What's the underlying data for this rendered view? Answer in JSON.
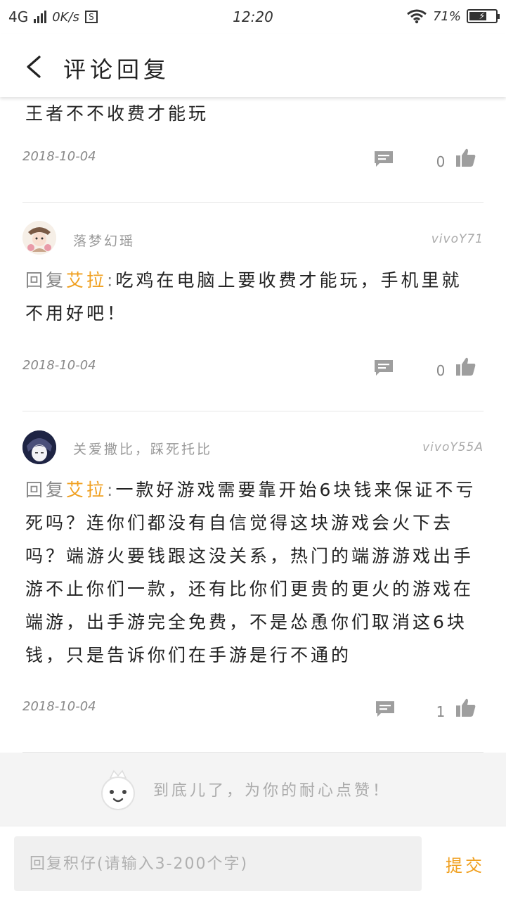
{
  "status_bar": {
    "network": "4G",
    "speed": "0K/s",
    "sim_badge": "S",
    "time": "12:20",
    "battery_text": "71%",
    "battery_level_percent": 71,
    "icons": [
      "signal-icon",
      "sim-icon",
      "wifi-icon",
      "battery-icon"
    ]
  },
  "header": {
    "title": "评论回复",
    "back_icon": "chevron-left-icon"
  },
  "comments": [
    {
      "text": "王者不不收费才能玩",
      "date": "2018-10-04",
      "likes": "0"
    },
    {
      "user": "落梦幻瑶",
      "device": "vivoY71",
      "reply_prefix": "回复",
      "mention": "艾拉",
      "colon": ":",
      "text": "吃鸡在电脑上要收费才能玩，手机里就不用好吧！",
      "date": "2018-10-04",
      "likes": "0"
    },
    {
      "user": "关爱撒比，踩死托比",
      "device": "vivoY55A",
      "reply_prefix": "回复",
      "mention": "艾拉",
      "colon": ":",
      "text": "一款好游戏需要靠开始6块钱来保证不亏死吗？连你们都没有自信觉得这块游戏会火下去吗？端游火要钱跟这没关系，热门的端游游戏出手游不止你们一款，还有比你们更贵的更火的游戏在端游，出手游完全免费，不是怂恿你们取消这6块钱，只是告诉你们在手游是行不通的",
      "date": "2018-10-04",
      "likes": "1"
    }
  ],
  "footer": {
    "end_text": "到底儿了，为你的耐心点赞！"
  },
  "reply_bar": {
    "placeholder": "回复积仔(请输入3-200个字)",
    "submit_label": "提交"
  },
  "colors": {
    "accent": "#f0a020",
    "muted_text": "#888888",
    "divider": "#e6e6e6",
    "footer_bg": "#f4f4f4"
  }
}
